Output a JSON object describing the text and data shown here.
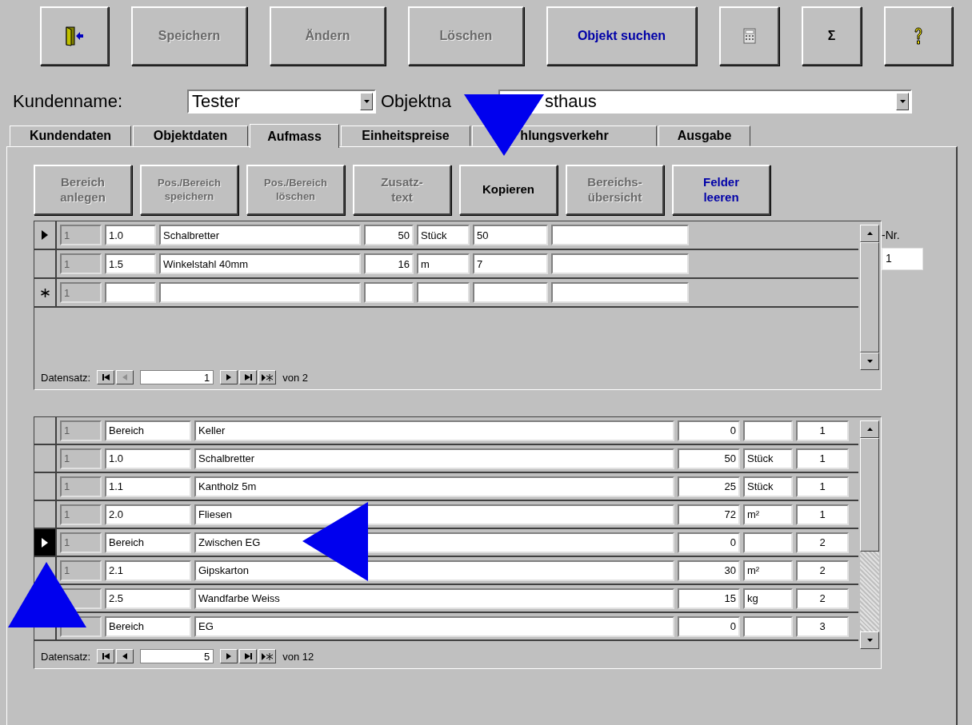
{
  "toolbar": [
    {
      "kind": "exit"
    },
    {
      "kind": "text",
      "label": "Speichern",
      "disabled": true
    },
    {
      "kind": "text",
      "label": "Ändern",
      "disabled": true
    },
    {
      "kind": "text",
      "label": "Löschen",
      "disabled": true
    },
    {
      "kind": "text",
      "label": "Objekt suchen",
      "disabled": false,
      "color": "#0000a8"
    },
    {
      "kind": "calculator"
    },
    {
      "kind": "text",
      "label": "Σ",
      "disabled": false
    },
    {
      "kind": "help"
    }
  ],
  "header": {
    "customer_label": "Kundenname:",
    "customer_value": "Tester",
    "object_label": "Objektna",
    "object_value": "sthaus"
  },
  "tabs": [
    {
      "label": "Kundendaten",
      "selected": false
    },
    {
      "label": "Objektdaten",
      "selected": false
    },
    {
      "label": "Aufmass",
      "selected": true
    },
    {
      "label": "Einheitspreise",
      "selected": false
    },
    {
      "label": "hlungsverkehr",
      "selected": false
    },
    {
      "label": "Ausgabe",
      "selected": false
    }
  ],
  "actions": [
    {
      "label": "Bereich\nanlegen",
      "disabled": true
    },
    {
      "label": "Pos./Bereich\nspeichern",
      "disabled": true
    },
    {
      "label": "Pos./Bereich\nlöschen",
      "disabled": true
    },
    {
      "label": "Zusatz-\ntext",
      "disabled": true
    },
    {
      "label": "Kopieren",
      "disabled": false
    },
    {
      "label": "Bereichs-\nübersicht",
      "disabled": true
    },
    {
      "label": "Felder\nleeren",
      "disabled": false,
      "color": "#0000a8"
    }
  ],
  "positions": {
    "rows": [
      {
        "kind": "record",
        "current": true,
        "column_1": "1",
        "column_2": "1.0",
        "column_3": "Schalbretter",
        "column_4": "50",
        "column_5": "Stück",
        "column_6": "50"
      },
      {
        "kind": "record",
        "current": false,
        "column_1": "1",
        "column_2": "1.5",
        "column_3": "Winkelstahl 40mm",
        "column_4": "16",
        "column_5": "m",
        "column_6": "7"
      },
      {
        "kind": "new",
        "column_1": "1"
      }
    ],
    "nav": {
      "label": "Datensatz:",
      "value": "1",
      "total": "von 2",
      "prev_disabled": true
    }
  },
  "nr": {
    "label": "-Nr.",
    "value": "1"
  },
  "overview": {
    "rows": [
      {
        "current": false,
        "column_1": "1",
        "column_2": "Bereich",
        "column_3": "Keller",
        "column_4": "0",
        "column_6": "1"
      },
      {
        "current": false,
        "column_1": "1",
        "column_2": "1.0",
        "column_3": "Schalbretter",
        "column_4": "50",
        "column_5": "Stück",
        "column_6": "1"
      },
      {
        "current": false,
        "column_1": "1",
        "column_2": "1.1",
        "column_3": "Kantholz 5m",
        "column_4": "25",
        "column_5": "Stück",
        "column_6": "1"
      },
      {
        "current": false,
        "column_1": "1",
        "column_2": "2.0",
        "column_3": "Fliesen",
        "column_4": "72",
        "column_5": "m²",
        "column_6": "1"
      },
      {
        "current": true,
        "column_1": "1",
        "column_2": "Bereich",
        "column_3": "Zwischen EG",
        "column_4": "0",
        "column_6": "2"
      },
      {
        "column_1": "1",
        "column_2": "2.1",
        "column_3": "Gipskarton",
        "column_4": "30",
        "column_5": "m²",
        "column_6": "2"
      },
      {
        "column_2": "2.5",
        "column_3": "Wandfarbe Weiss",
        "column_4": "15",
        "column_5": "kg",
        "column_6": "2"
      },
      {
        "column_2": "Bereich",
        "column_3": "EG",
        "column_4": "0",
        "column_6": "3"
      }
    ],
    "nav": {
      "label": "Datensatz:",
      "value": "5",
      "total": "von 12",
      "prev_disabled": false
    }
  }
}
